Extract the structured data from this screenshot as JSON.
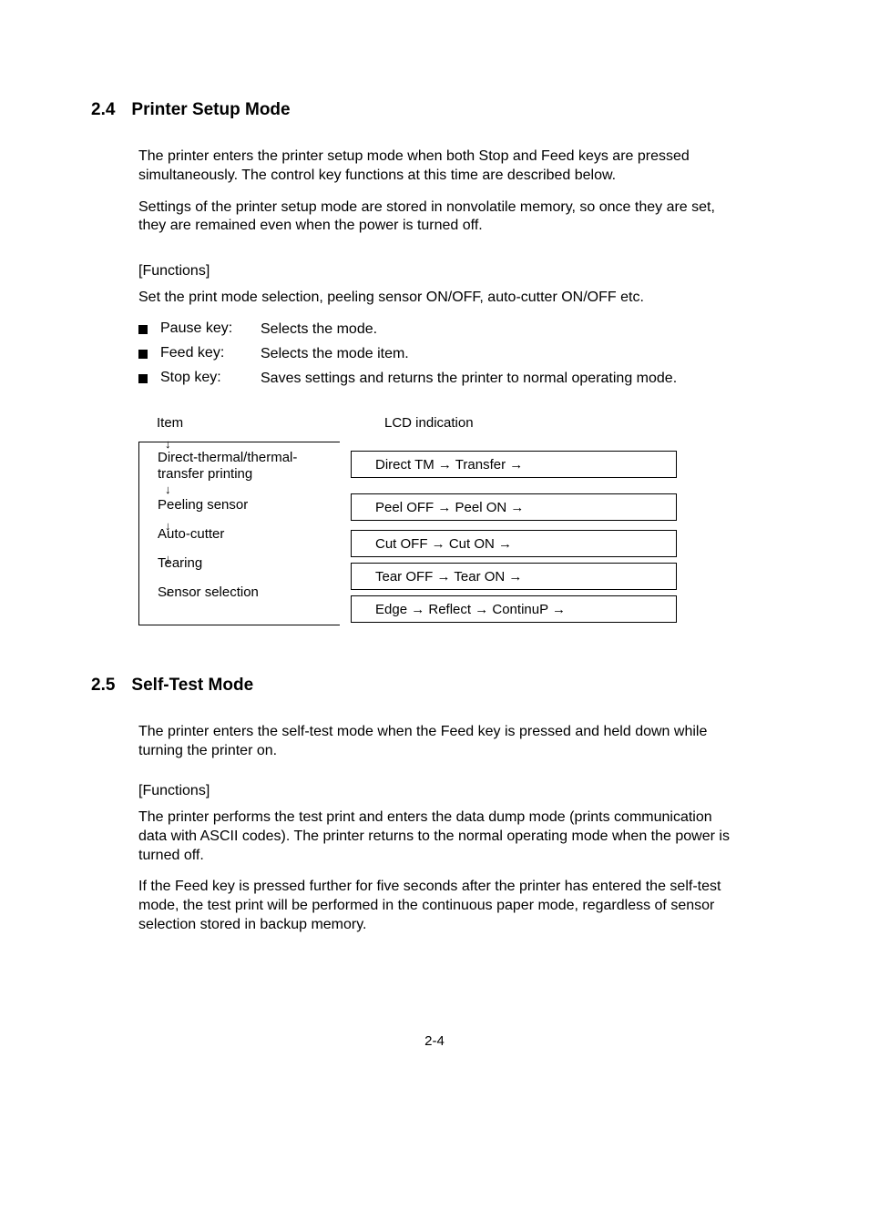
{
  "section24": {
    "number": "2.4",
    "title": "Printer Setup Mode",
    "para1": "The printer enters the printer setup mode when both Stop and Feed keys are pressed simultaneously.  The control key functions at this time are described below.",
    "para2": "Settings of the printer setup mode are stored in nonvolatile memory, so once they are set, they are remained even when the power is turned off.",
    "functions_label": "[Functions]",
    "functions_desc": "Set the print mode selection, peeling sensor ON/OFF, auto-cutter ON/OFF etc.",
    "keys": [
      {
        "name": "Pause key:",
        "desc": "Selects the mode."
      },
      {
        "name": "Feed key:",
        "desc": "Selects the mode item."
      },
      {
        "name": "Stop key:",
        "desc": "Saves settings and returns the printer to normal operating mode."
      }
    ],
    "table": {
      "header_item": "Item",
      "header_lcd": "LCD indication",
      "rows": [
        {
          "item": "Direct-thermal/thermal-transfer printing",
          "lcd": "Direct TM  →  Transfer  →"
        },
        {
          "item": "Peeling sensor",
          "lcd": "Peel OFF  →  Peel ON  →"
        },
        {
          "item": "Auto-cutter",
          "lcd": "Cut OFF  →  Cut ON  →"
        },
        {
          "item": "Tearing",
          "lcd": "Tear OFF  →  Tear ON  →"
        },
        {
          "item": "Sensor selection",
          "lcd": "Edge  →  Reflect  →  ContinuP  →"
        }
      ]
    }
  },
  "section25": {
    "number": "2.5",
    "title": "Self-Test  Mode",
    "para1": "The printer enters the self-test mode when the Feed key is pressed and held down while turning the printer on.",
    "functions_label": "[Functions]",
    "para2": "The printer performs the test print and enters the data dump mode (prints communication data with ASCII codes).  The printer returns to the normal operating mode when the power is turned off.",
    "para3": "If the Feed key is pressed further for five seconds after the printer has entered the self-test mode, the test print will be performed in the continuous paper mode, regardless of sensor selection stored in backup memory."
  },
  "page_number": "2-4"
}
